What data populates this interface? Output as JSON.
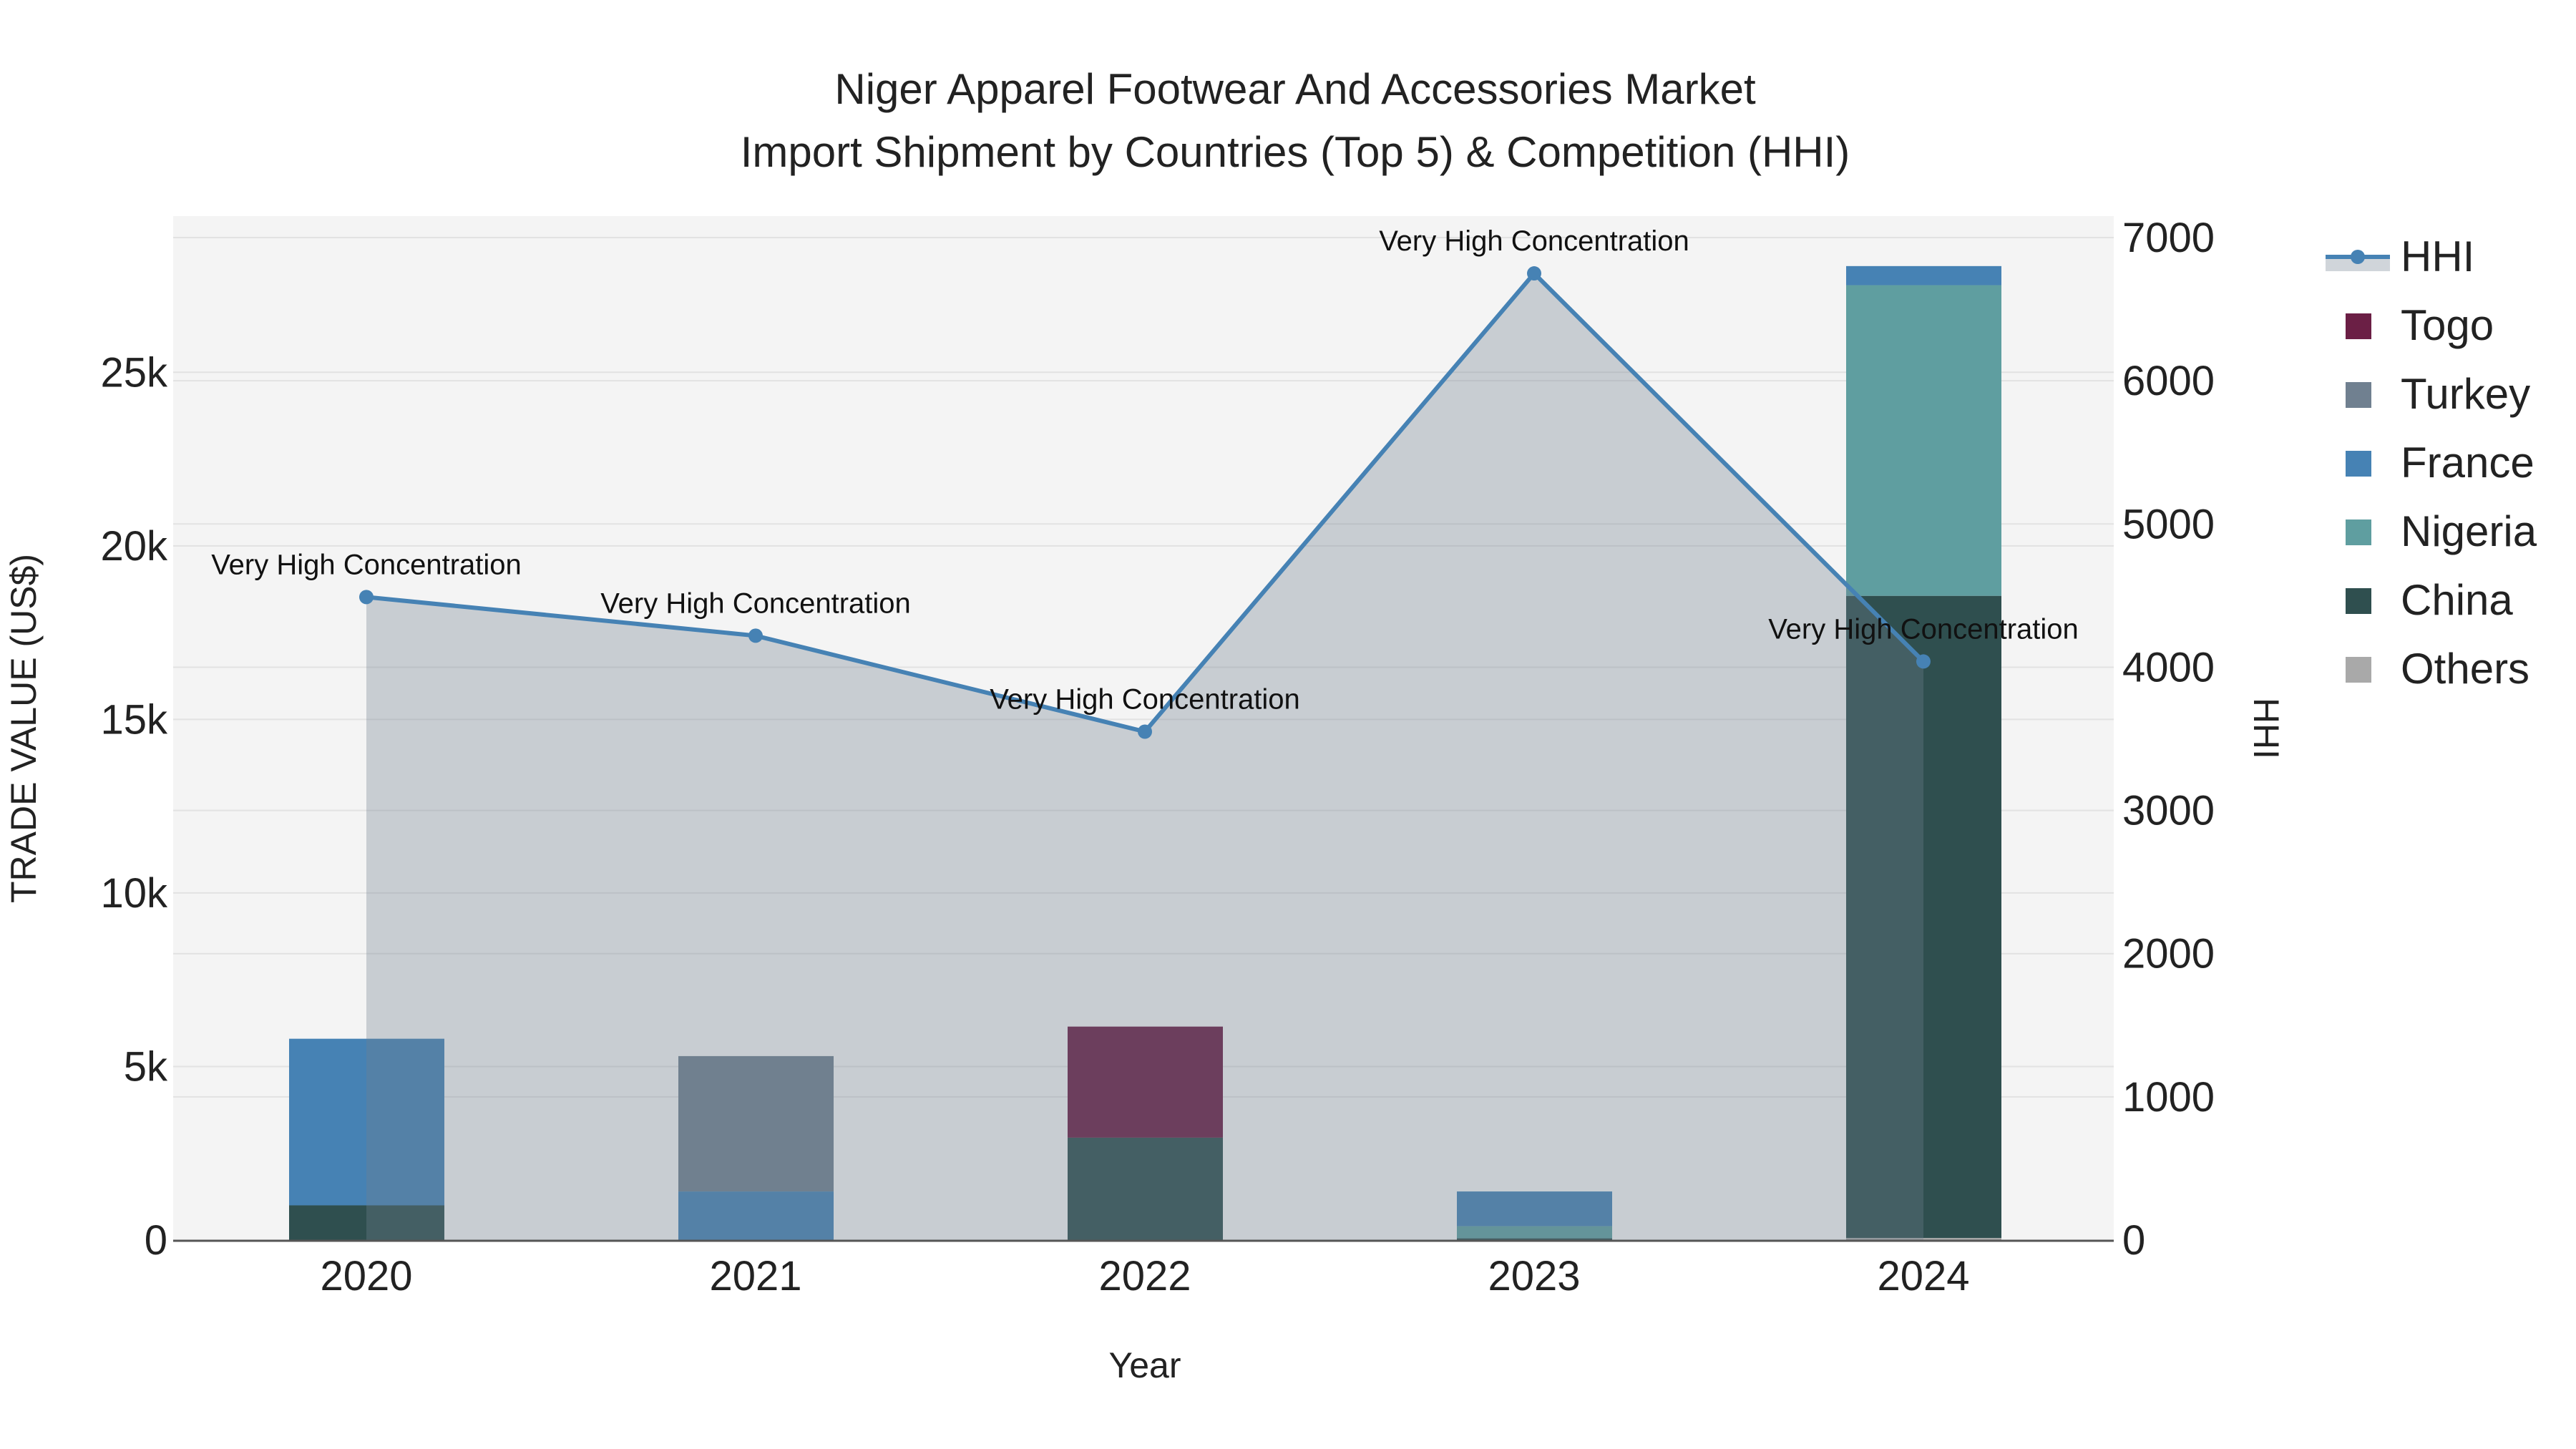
{
  "chart_data": {
    "type": "bar",
    "title_line1": "Niger Apparel Footwear And Accessories Market",
    "title_line2": "Import Shipment by Countries (Top 5) & Competition (HHI)",
    "xlabel": "Year",
    "ylabel": "TRADE VALUE (US$)",
    "y2label": "HHI",
    "categories": [
      "2020",
      "2021",
      "2022",
      "2023",
      "2024"
    ],
    "ylim": [
      0,
      29500
    ],
    "y2lim": [
      0,
      7150
    ],
    "yticks": [
      0,
      5000,
      10000,
      15000,
      20000,
      25000
    ],
    "ytick_labels": [
      "0",
      "5k",
      "10k",
      "15k",
      "20k",
      "25k"
    ],
    "y2ticks": [
      0,
      1000,
      2000,
      3000,
      4000,
      5000,
      6000,
      7000
    ],
    "y2tick_labels": [
      "0",
      "1000",
      "2000",
      "3000",
      "4000",
      "5000",
      "6000",
      "7000"
    ],
    "series": [
      {
        "name": "Others",
        "color": "#a9a9a9",
        "values": [
          0,
          0,
          0,
          0,
          60
        ]
      },
      {
        "name": "China",
        "color": "#2f4f4f",
        "values": [
          1000,
          0,
          2950,
          50,
          18500
        ]
      },
      {
        "name": "Nigeria",
        "color": "#5f9ea0",
        "values": [
          0,
          0,
          0,
          350,
          8950
        ]
      },
      {
        "name": "France",
        "color": "#4682b4",
        "values": [
          4800,
          1400,
          0,
          1000,
          550
        ]
      },
      {
        "name": "Turkey",
        "color": "#708090",
        "values": [
          0,
          3900,
          0,
          0,
          0
        ]
      },
      {
        "name": "Togo",
        "color": "#6b1f45",
        "values": [
          0,
          0,
          3200,
          0,
          0
        ]
      }
    ],
    "hhi": {
      "name": "HHI",
      "color": "#4682b4",
      "values": [
        4490,
        4220,
        3550,
        6750,
        4040
      ],
      "labels": [
        "Very High Concentration",
        "Very High Concentration",
        "Very High Concentration",
        "Very High Concentration",
        "Very High Concentration"
      ]
    },
    "legend": [
      "HHI",
      "Togo",
      "Turkey",
      "France",
      "Nigeria",
      "China",
      "Others"
    ],
    "legend_position": "top-right"
  }
}
